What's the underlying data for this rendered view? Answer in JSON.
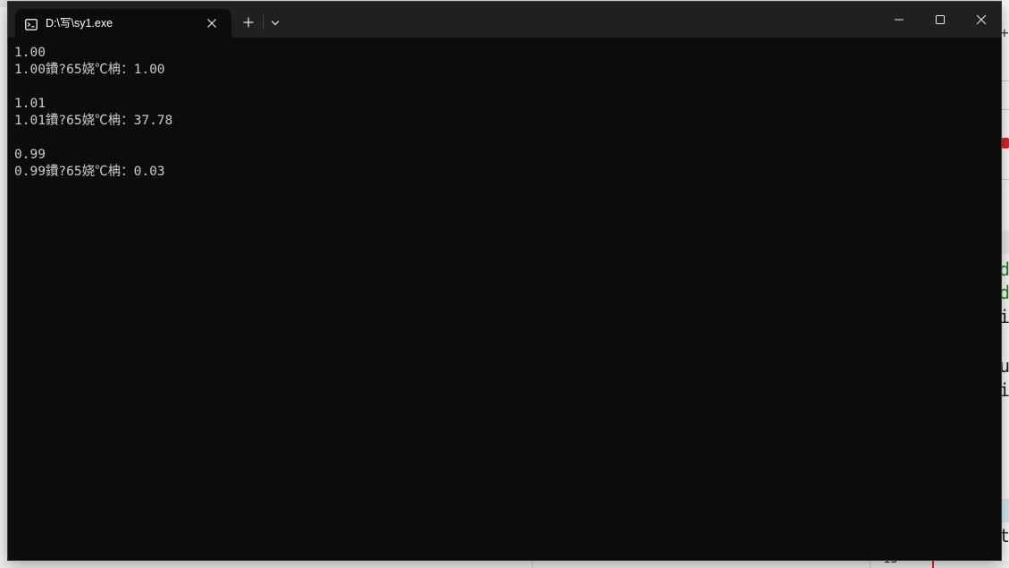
{
  "window": {
    "tab_title": "D:\\写\\sy1.exe",
    "tab_icon": "console-icon",
    "close_tab_icon": "close-icon",
    "new_tab_icon": "plus-icon",
    "dropdown_icon": "chevron-down-icon",
    "minimize_icon": "minimize-icon",
    "maximize_icon": "maximize-icon",
    "close_window_icon": "close-icon"
  },
  "console": {
    "lines": [
      "1.00",
      "1.00鐨?65娆℃柟：1.00",
      "",
      "1.01",
      "1.01鐨?65娆℃柟：37.78",
      "",
      "0.99",
      "0.99鐨?65娆℃柟：0.03"
    ]
  },
  "background_editor": {
    "peek_chars": [
      "d",
      "d",
      "i",
      "u",
      "i",
      "t",
      "+",
      "15"
    ]
  },
  "colors": {
    "console_bg": "#0c0c0c",
    "titlebar_bg": "#202020",
    "console_text": "#cccccc",
    "bg_green": "#1a8a1a",
    "bg_red": "#e0242a"
  }
}
